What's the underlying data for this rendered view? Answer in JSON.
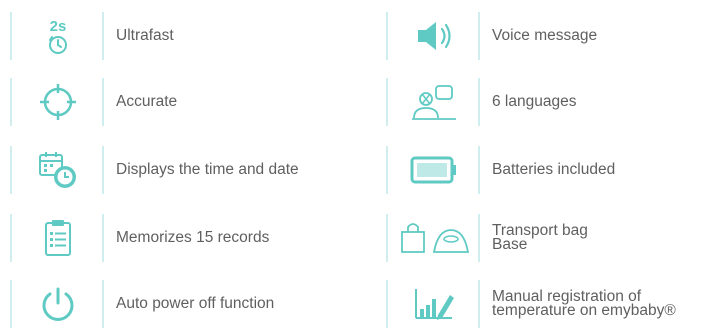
{
  "colors": {
    "accent": "#5fcac3",
    "accent_light": "#bfe9e6",
    "text": "#5f5f5f",
    "divider": "#cfeeed"
  },
  "features": [
    {
      "icon": "timer-2s-icon",
      "icon_text": "2s",
      "label": "Ultrafast"
    },
    {
      "icon": "voice-speaker-icon",
      "label": "Voice message"
    },
    {
      "icon": "crosshair-icon",
      "label": "Accurate"
    },
    {
      "icon": "languages-people-icon",
      "label": "6 languages"
    },
    {
      "icon": "calendar-clock-icon",
      "label": "Displays the time and date"
    },
    {
      "icon": "battery-icon",
      "label": "Batteries included"
    },
    {
      "icon": "clipboard-list-icon",
      "label": "Memorizes 15 records"
    },
    {
      "icon": "bag-and-base-icon",
      "label_lines": [
        "Transport bag",
        "Base"
      ]
    },
    {
      "icon": "power-icon",
      "label": "Auto power off function"
    },
    {
      "icon": "chart-pencil-icon",
      "label_lines": [
        "Manual registration of",
        "temperature on emybaby®"
      ]
    }
  ]
}
